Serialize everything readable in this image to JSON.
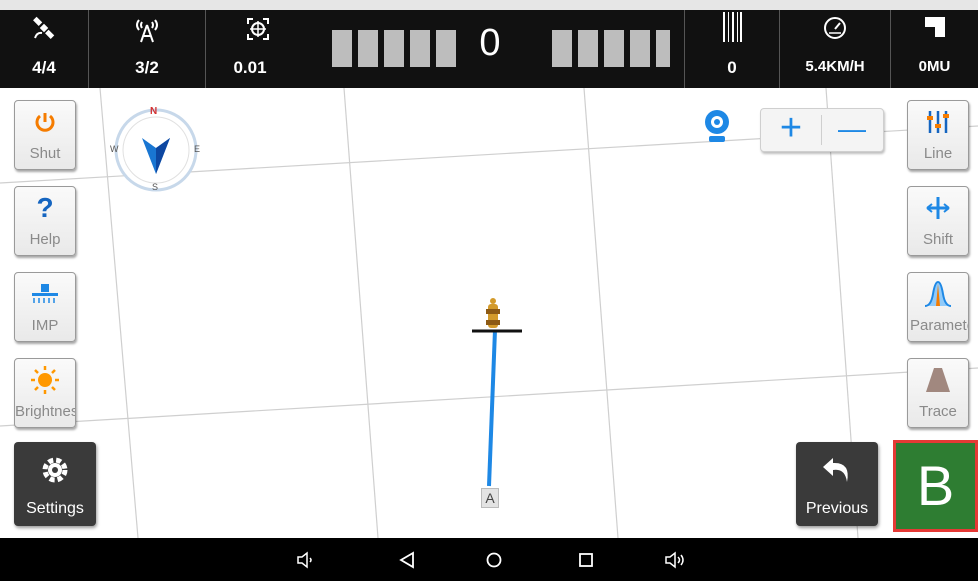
{
  "status_bar": {
    "satellites": {
      "icon": "satellite-icon",
      "value": "4/4"
    },
    "signal": {
      "icon": "antenna-icon",
      "value": "3/2"
    },
    "precision": {
      "icon": "target-icon",
      "value": "0.01"
    },
    "deviation": {
      "value": "0",
      "left_bars": 5,
      "right_bars": 5
    },
    "count": {
      "icon": "barcode-icon",
      "value": "0"
    },
    "speed": {
      "icon": "speedometer-icon",
      "value": "5.4KM/H"
    },
    "area": {
      "icon": "area-icon",
      "value": "0MU"
    }
  },
  "left_buttons": {
    "shut": {
      "label": "Shut",
      "icon": "power-icon"
    },
    "help": {
      "label": "Help",
      "icon": "question-icon"
    },
    "imp": {
      "label": "IMP",
      "icon": "implement-icon"
    },
    "brightness": {
      "label": "Brightness",
      "icon": "sun-icon"
    },
    "settings": {
      "label": "Settings",
      "icon": "gear-icon"
    }
  },
  "right_buttons": {
    "line": {
      "label": "Line",
      "icon": "line-icon"
    },
    "shift": {
      "label": "Shift",
      "icon": "shift-icon"
    },
    "params": {
      "label": "Parameters",
      "icon": "params-icon"
    },
    "trace": {
      "label": "Trace",
      "icon": "trace-icon"
    },
    "previous": {
      "label": "Previous",
      "icon": "undo-icon"
    },
    "b_point": {
      "label": "B"
    }
  },
  "map": {
    "compass": {
      "n": "N",
      "s": "S",
      "e": "E",
      "w": "W"
    },
    "point_a_label": "A",
    "zoom_in": "+",
    "zoom_out": "—",
    "line_color": "#1e88e5"
  },
  "colors": {
    "accent": "#1e88e5",
    "b_button": "#2e7d32",
    "highlight_border": "#e53935",
    "topbar": "#111111"
  }
}
